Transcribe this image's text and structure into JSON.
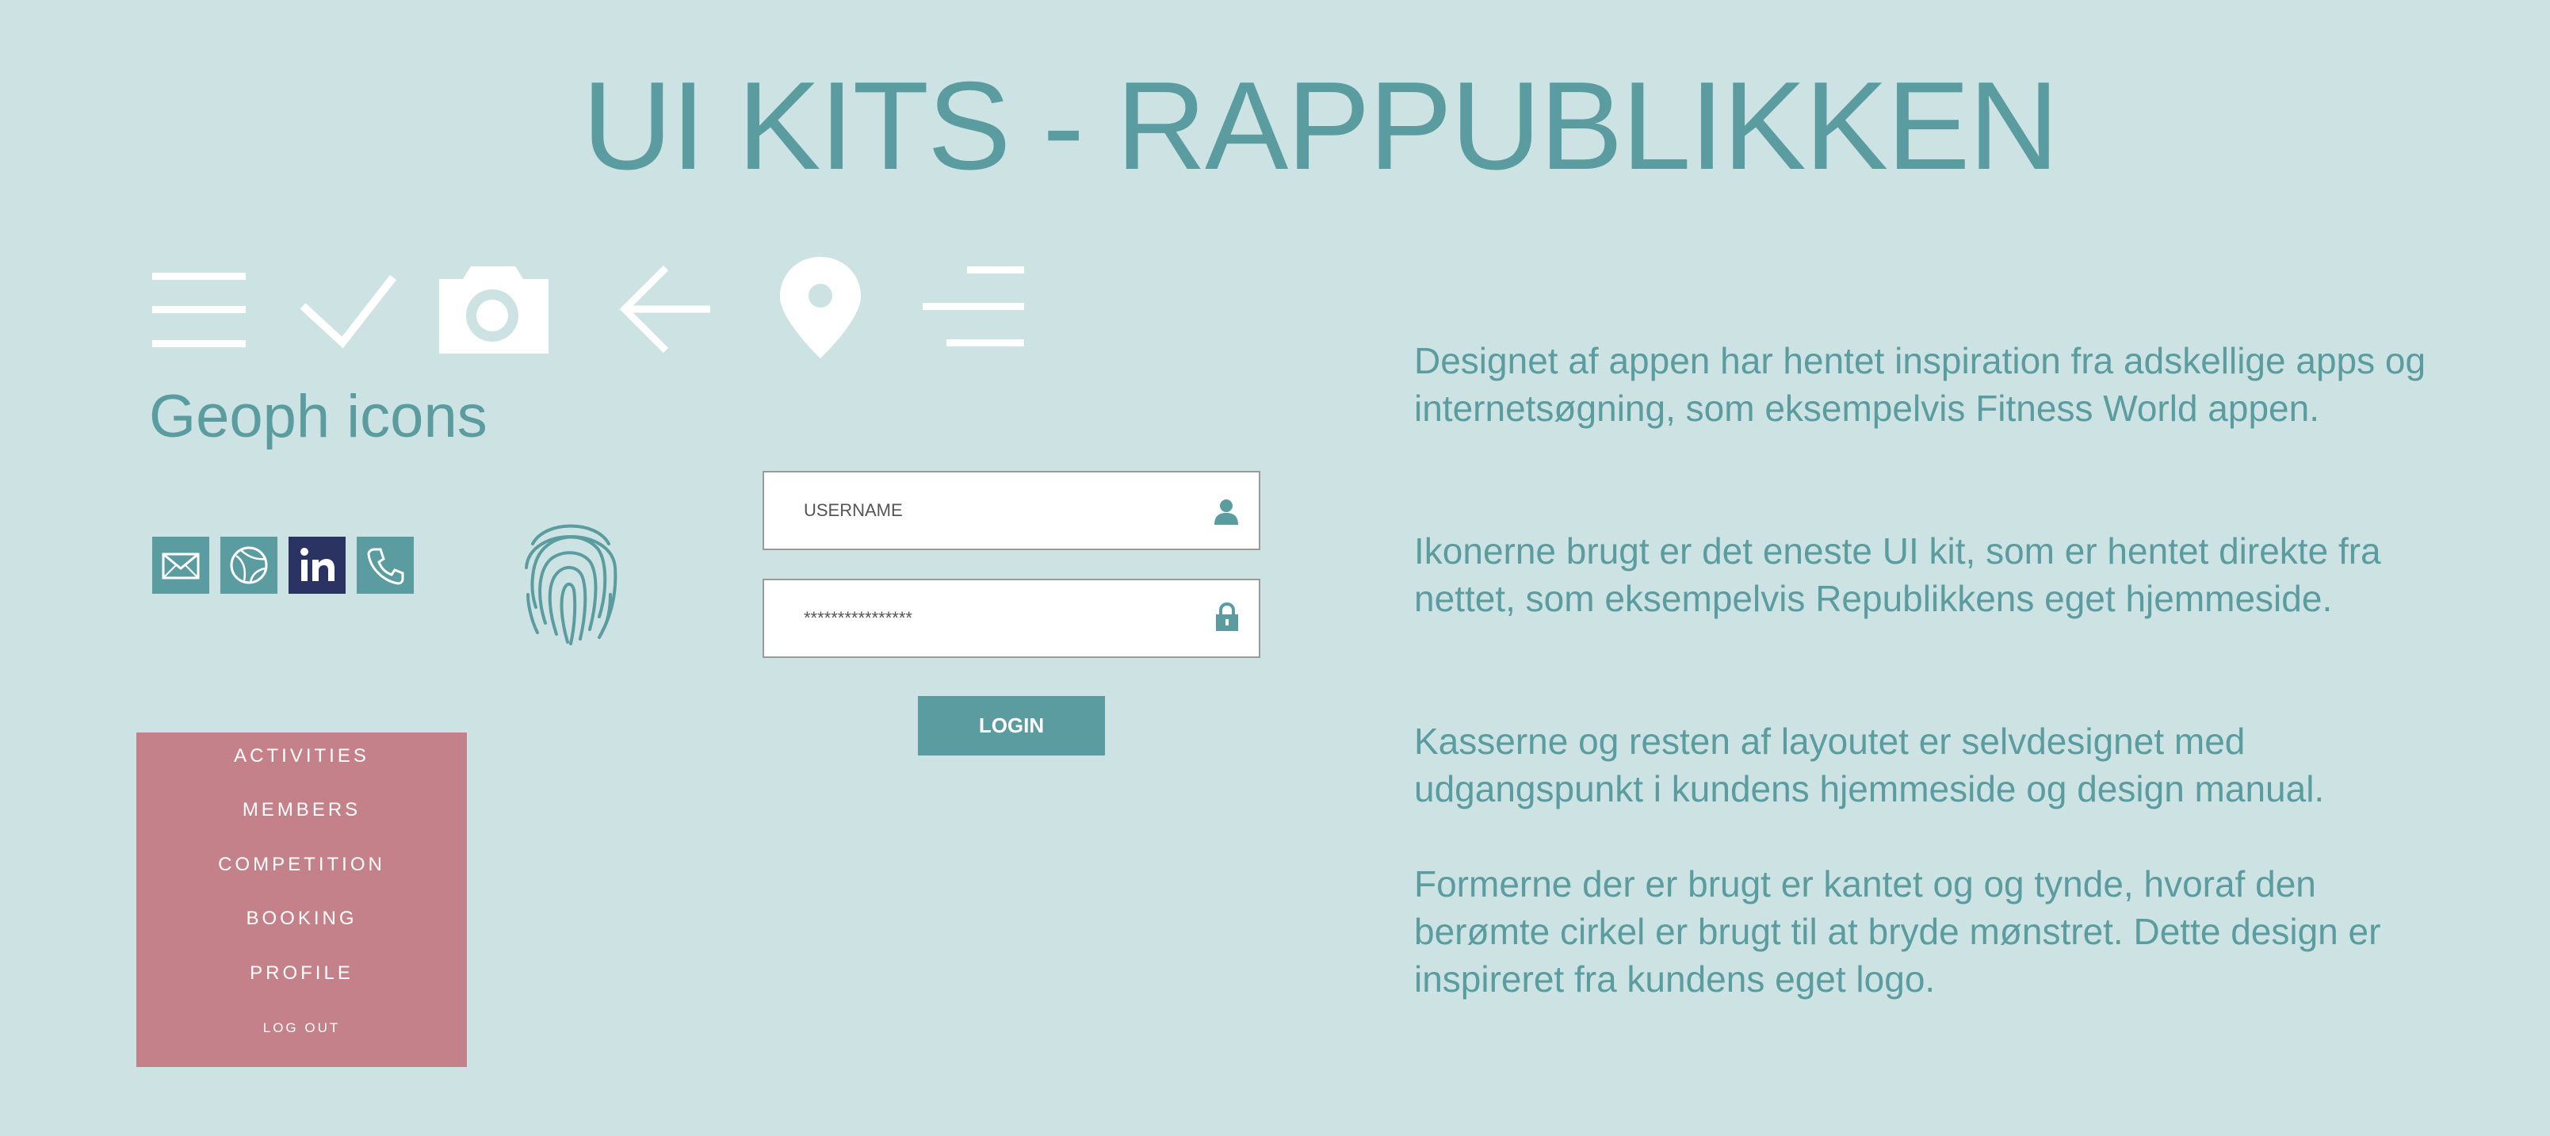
{
  "header": {
    "title": "UI KITS - RAPPUBLIKKEN"
  },
  "icon_set": {
    "title": "Geoph icons",
    "icons": [
      "hamburger-menu-icon",
      "checkmark-icon",
      "camera-icon",
      "arrow-left-icon",
      "location-pin-icon",
      "align-right-menu-icon"
    ]
  },
  "social_icons": [
    "email-icon",
    "globe-icon",
    "linkedin-icon",
    "phone-icon"
  ],
  "fingerprint": "fingerprint-icon",
  "login_form": {
    "username_placeholder": "USERNAME",
    "password_value": "****************",
    "login_label": "LOGIN"
  },
  "menu": {
    "items": [
      "ACTIVITIES",
      "MEMBERS",
      "COMPETITION",
      "BOOKING",
      "PROFILE",
      "LOG OUT"
    ]
  },
  "description": {
    "paragraphs": [
      "Designet af appen har hentet inspiration fra adskellige apps og internetsøgning, som eksempelvis Fitness World appen.",
      "Ikonerne brugt er det eneste UI kit, som er hentet direkte fra nettet, som eksempelvis Republikkens eget hjemmeside.",
      "Kasserne og resten af layoutet er selvdesignet med udgangspunkt i kundens hjemmeside og design manual.",
      "Formerne der er brugt er kantet og og tynde, hvoraf den berømte cirkel er brugt til at bryde mønstret. Dette design er inspireret fra kundens eget logo."
    ]
  },
  "colors": {
    "background": "#cde3e3",
    "accent": "#5a9c9f",
    "menu": "#c5818a",
    "linkedin": "#2a3361"
  }
}
